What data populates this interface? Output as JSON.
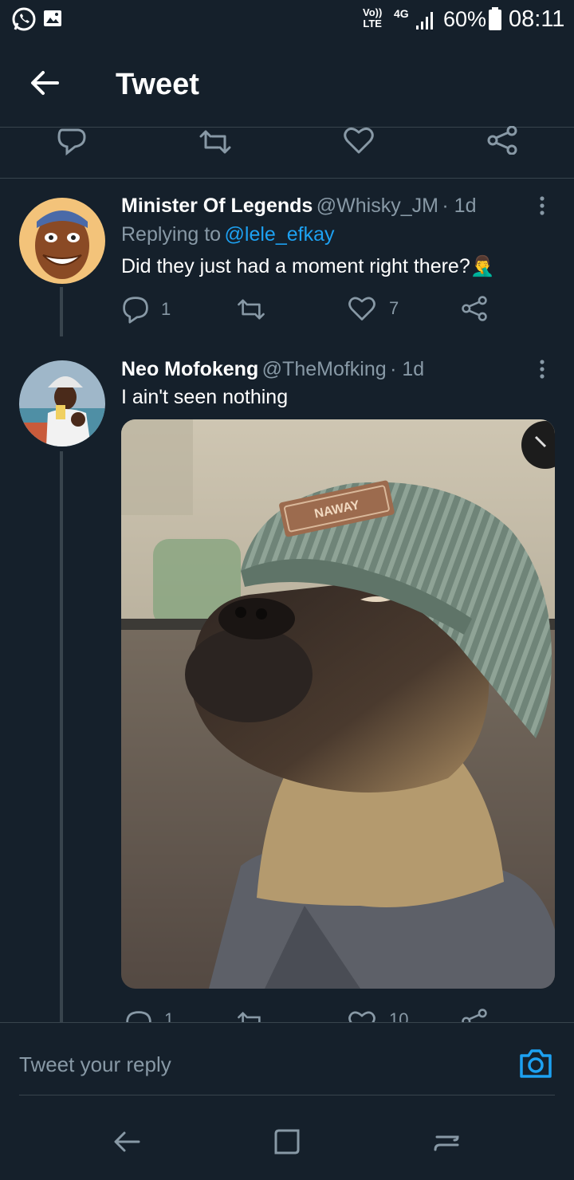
{
  "status_bar": {
    "network_label_1": "Vo))",
    "network_label_2": "LTE",
    "network_type": "4G",
    "battery": "60%",
    "time": "08:11"
  },
  "header": {
    "title": "Tweet",
    "back_icon": "arrow-left-icon"
  },
  "tweets": [
    {
      "author": "Minister Of Legends",
      "handle": "@Whisky_JM",
      "time": "· 1d",
      "replying_prefix": "Replying to",
      "replying_to": "@lele_efkay",
      "text": "Did they just had a moment right there?",
      "emoji": "🤦‍♂️",
      "replies": "1",
      "likes": "7"
    },
    {
      "author": "Neo Mofokeng",
      "handle": "@TheMofking",
      "time": "· 1d",
      "text": "I ain't seen nothing",
      "replies": "1",
      "likes": "10",
      "media_text": "NAWAY"
    }
  ],
  "reply_bar": {
    "placeholder": "Tweet your reply"
  },
  "colors": {
    "background": "#15202b",
    "accent": "#1da1f2",
    "muted": "#8899a6",
    "divider": "#38444d"
  }
}
